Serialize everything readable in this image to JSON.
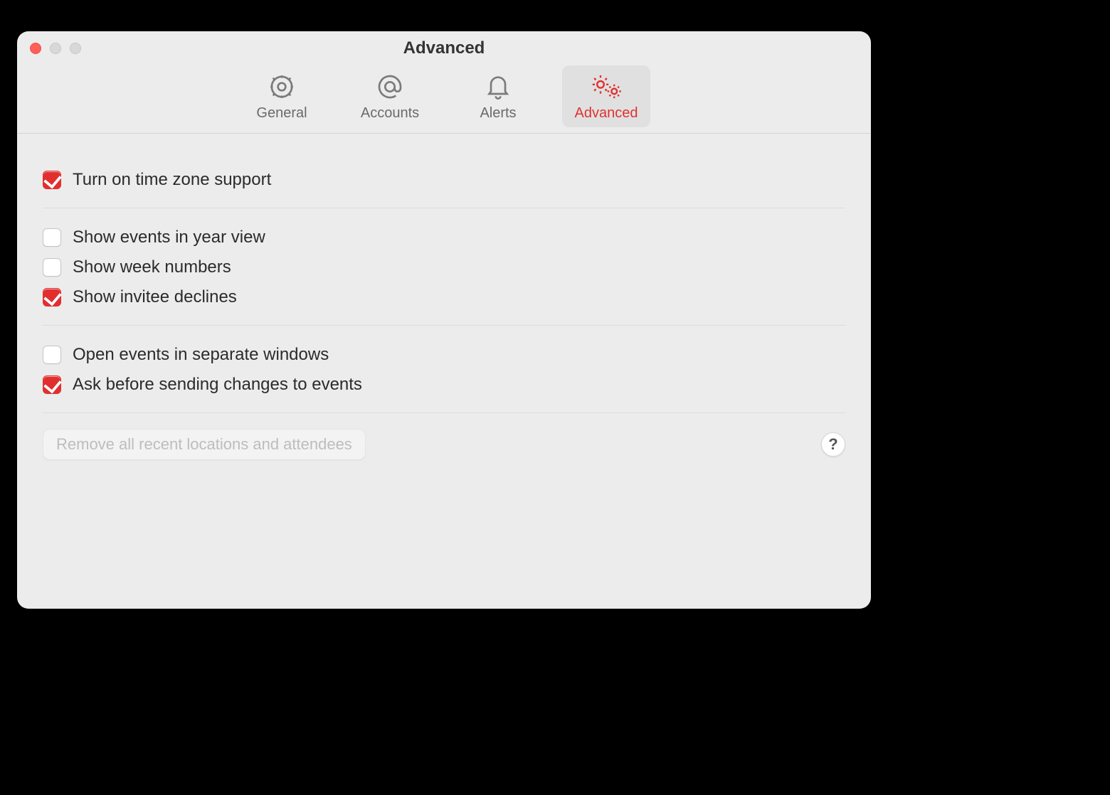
{
  "window": {
    "title": "Advanced"
  },
  "toolbar": {
    "items": [
      {
        "label": "General",
        "id": "general",
        "active": false
      },
      {
        "label": "Accounts",
        "id": "accounts",
        "active": false
      },
      {
        "label": "Alerts",
        "id": "alerts",
        "active": false
      },
      {
        "label": "Advanced",
        "id": "advanced",
        "active": true
      }
    ]
  },
  "options": {
    "timezone": {
      "label": "Turn on time zone support",
      "checked": true
    },
    "year_view": {
      "label": "Show events in year view",
      "checked": false
    },
    "week_numbers": {
      "label": "Show week numbers",
      "checked": false
    },
    "invitee_declines": {
      "label": "Show invitee declines",
      "checked": true
    },
    "separate_windows": {
      "label": "Open events in separate windows",
      "checked": false
    },
    "ask_before_send": {
      "label": "Ask before sending changes to events",
      "checked": true
    }
  },
  "footer": {
    "remove_button": "Remove all recent locations and attendees",
    "help": "?"
  },
  "colors": {
    "accent": "#e12f2f"
  }
}
